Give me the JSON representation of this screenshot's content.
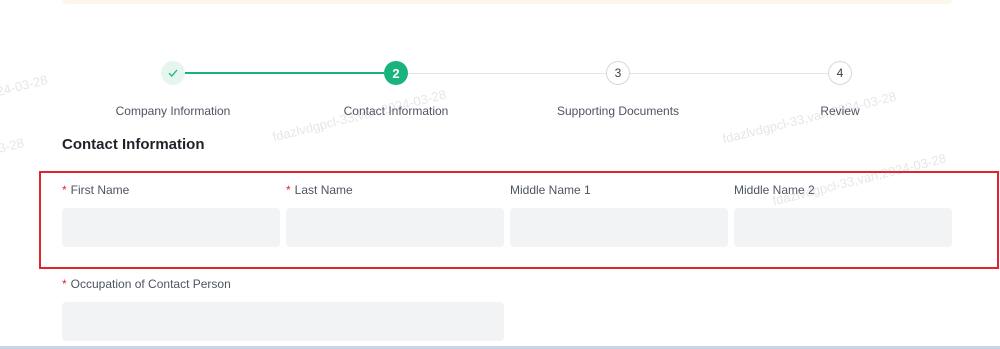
{
  "stepper": {
    "steps": [
      {
        "number": "",
        "label": "Company Information",
        "state": "done"
      },
      {
        "number": "2",
        "label": "Contact Information",
        "state": "active"
      },
      {
        "number": "3",
        "label": "Supporting Documents",
        "state": "pending"
      },
      {
        "number": "4",
        "label": "Review",
        "state": "pending"
      }
    ],
    "check_icon": "check-icon"
  },
  "section": {
    "title": "Contact Information"
  },
  "form": {
    "first_name": {
      "label": "First Name",
      "required_mark": "*",
      "value": ""
    },
    "last_name": {
      "label": "Last Name",
      "required_mark": "*",
      "value": ""
    },
    "middle_name_1": {
      "label": "Middle Name 1",
      "value": ""
    },
    "middle_name_2": {
      "label": "Middle Name 2",
      "value": ""
    },
    "occupation": {
      "label": "Occupation of Contact Person",
      "required_mark": "*",
      "value": ""
    }
  },
  "watermark": {
    "texts": [
      "24-03-28",
      "fdazlvdgpcl-33,van,2024-03-28",
      "fdazlvdgpcl-33,van,2024-03-28",
      "3-28",
      "fdazlvdgpcl-33,van,2024-03-28"
    ]
  },
  "colors": {
    "accent": "#19b37e",
    "required": "#e0242f",
    "highlight": "#e0242f",
    "input_bg": "#f2f3f5"
  }
}
